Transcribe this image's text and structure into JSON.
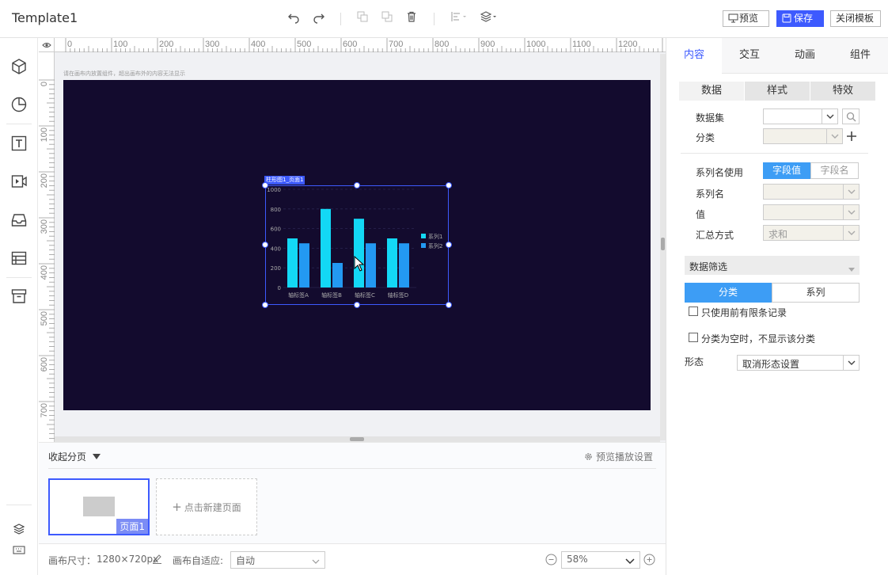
{
  "app": {
    "title": "Template1"
  },
  "toolbar": {
    "preview": "预览",
    "save": "保存",
    "close": "关闭模板"
  },
  "canvas": {
    "hint": "请在画布内放置组件，超出画布外的内容无法显示",
    "ruler_x": [
      "0",
      "100",
      "200",
      "300",
      "400",
      "500",
      "600",
      "700",
      "800",
      "900",
      "1000",
      "1100",
      "1200"
    ],
    "ruler_y": [
      "0",
      "100",
      "200",
      "300",
      "400",
      "500",
      "600",
      "700"
    ],
    "component_tag": "柱形图1_页面1"
  },
  "chart_data": {
    "type": "bar",
    "categories": [
      "轴标签A",
      "轴标签B",
      "轴标签C",
      "轴标签D"
    ],
    "series": [
      {
        "name": "系列1",
        "values": [
          500,
          800,
          700,
          500
        ],
        "color": "#13d8f5"
      },
      {
        "name": "系列2",
        "values": [
          450,
          250,
          450,
          450
        ],
        "color": "#2399f2"
      }
    ],
    "yticks": [
      "0",
      "200",
      "400",
      "600",
      "800",
      "1000"
    ],
    "ylim": [
      0,
      1000
    ],
    "legend": "right"
  },
  "pages": {
    "collapse": "收起分页",
    "setting": "预览播放设置",
    "page1": "页面1",
    "new_page": "点击新建页面"
  },
  "footer": {
    "size_label": "画布尺寸：",
    "size_value": "1280×720px",
    "adapt_label": "画布自适应:",
    "adapt_value": "自动",
    "zoom": "58%"
  },
  "right": {
    "tabs": [
      "内容",
      "交互",
      "动画",
      "组件"
    ],
    "subtabs": [
      "数据",
      "样式",
      "特效"
    ],
    "dataset": "数据集",
    "category": "分类",
    "series_name_use": "系列名使用",
    "field_value": "字段值",
    "field_name": "字段名",
    "series_name": "系列名",
    "value": "值",
    "summary": "汇总方式",
    "summary_value": "求和",
    "filter": "数据筛选",
    "filter_cat": "分类",
    "filter_series": "系列",
    "limit_records": "只使用前有限条记录",
    "hide_empty": "分类为空时，不显示该分类",
    "form": "形态",
    "form_value": "取消形态设置"
  }
}
